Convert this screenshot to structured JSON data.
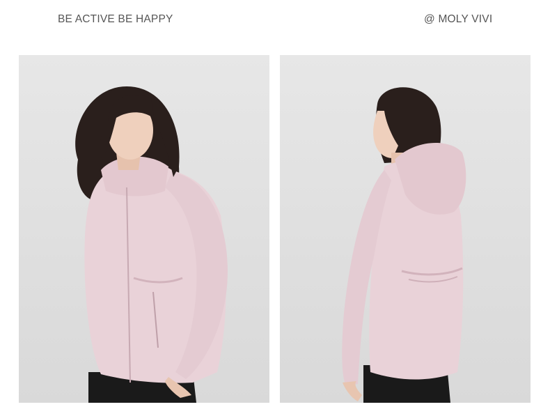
{
  "header": {
    "tagline": "BE ACTIVE BE HAPPY",
    "brand": "@ MOLY VIVI"
  },
  "photos": [
    {
      "view": "front",
      "subject": "woman wearing pink hooded zip-up jacket"
    },
    {
      "view": "back",
      "subject": "woman wearing pink hooded jacket, rear view with hood and drawstring waist"
    }
  ],
  "colors": {
    "background": "#ffffff",
    "studio_backdrop": "#e2e2e2",
    "jacket": "#e9d2d8",
    "hair": "#2a1f1c",
    "pants": "#1a1a1a",
    "text": "#555555"
  }
}
